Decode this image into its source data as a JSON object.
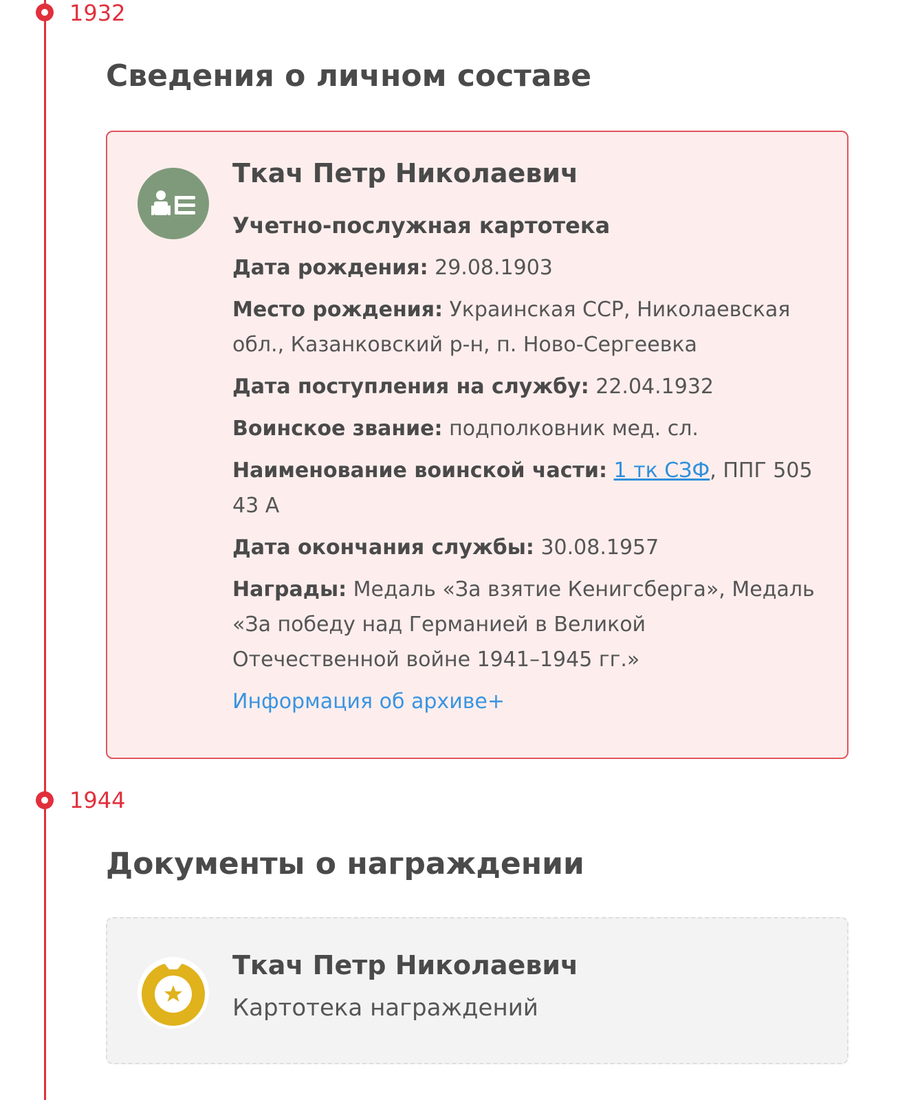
{
  "timeline": [
    {
      "year": "1932",
      "section_title": "Сведения о личном составе",
      "card": {
        "name": "Ткач Петр Николаевич",
        "doc_type": "Учетно-послужная картотека",
        "fields": {
          "birth_date": {
            "label": "Дата рождения:",
            "value": "29.08.1903"
          },
          "birth_place": {
            "label": "Место рождения:",
            "value": "Украинская ССР, Николаевская обл., Казанковский р-н, п. Ново-Сергеевка"
          },
          "service_start": {
            "label": "Дата поступления на службу:",
            "value": "22.04.1932"
          },
          "rank": {
            "label": "Воинское звание:",
            "value": "подполковник мед. сл."
          },
          "unit": {
            "label": "Наименование воинской части:",
            "link": "1 тк СЗФ",
            "value": ", ППГ 505 43 А"
          },
          "service_end": {
            "label": "Дата окончания службы:",
            "value": "30.08.1957"
          },
          "awards": {
            "label": "Награды:",
            "value": "Медаль «За взятие Кенигсберга», Медаль «За победу над Германией в Великой Отечественной войне 1941–1945 гг.»"
          }
        },
        "archive_link": "Информация об архиве+",
        "icon": "personnel-card-icon",
        "icon_color": "#7f9a7b"
      }
    },
    {
      "year": "1944",
      "section_title": "Документы о награждении",
      "card": {
        "name": "Ткач Петр Николаевич",
        "doc_type": "Картотека награждений",
        "icon": "medal-icon",
        "icon_color": "#e0b21c"
      }
    }
  ],
  "colors": {
    "accent": "#e0303c",
    "link": "#2f8fdc",
    "card_bg": "#fdeeed",
    "card_border": "#e0555c"
  }
}
